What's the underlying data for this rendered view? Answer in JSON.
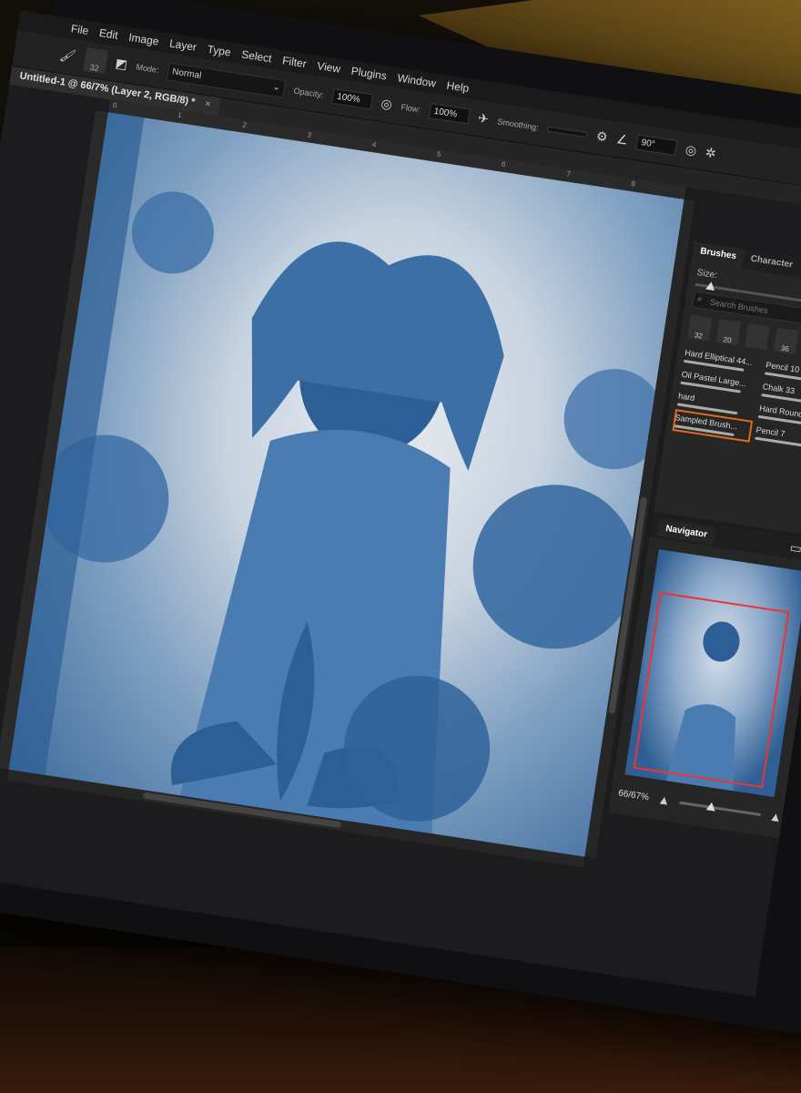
{
  "menu": [
    "File",
    "Edit",
    "Image",
    "Layer",
    "Type",
    "Select",
    "Filter",
    "View",
    "Plugins",
    "Window",
    "Help"
  ],
  "options": {
    "brush_size": "32",
    "mode_label": "Mode:",
    "mode_value": "Normal",
    "opacity_label": "Opacity:",
    "opacity_value": "100%",
    "flow_label": "Flow:",
    "flow_value": "100%",
    "smoothing_label": "Smoothing:",
    "angle_value": "90°"
  },
  "document_tab": {
    "title": "Untitled-1 @ 66/7% (Layer 2, RGB/8) *",
    "close": "×"
  },
  "ruler": [
    "0",
    "1",
    "2",
    "3",
    "4",
    "5",
    "6",
    "7",
    "8"
  ],
  "brushes_panel": {
    "tabs": [
      "Brushes",
      "Character"
    ],
    "size_label": "Size:",
    "search_placeholder": "Search Brushes",
    "preset_sizes": [
      "32",
      "20",
      "36",
      "48"
    ],
    "brushes": [
      {
        "name": "Hard Elliptical 44..."
      },
      {
        "name": "Pencil 10"
      },
      {
        "name": "Oil Pastel Large..."
      },
      {
        "name": "Chalk 33"
      },
      {
        "name": "hard"
      },
      {
        "name": "Hard Round"
      },
      {
        "name": "Sampled Brush..."
      },
      {
        "name": "Pencil 7"
      }
    ],
    "selected_brush": "Sampled Brush..."
  },
  "navigator": {
    "title": "Navigator",
    "zoom": "66/67%"
  },
  "colors": {
    "accent_selection": "#e06a20",
    "navigator_box": "#e33333"
  }
}
